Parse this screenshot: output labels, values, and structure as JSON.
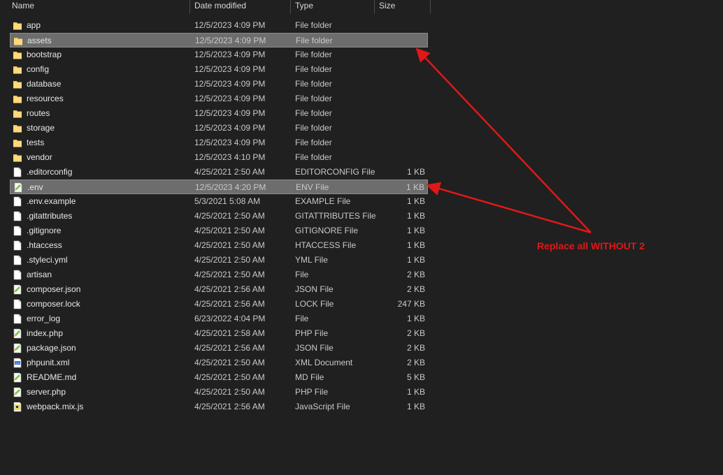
{
  "columns": {
    "name": "Name",
    "date": "Date modified",
    "type": "Type",
    "size": "Size"
  },
  "files": [
    {
      "name": "app",
      "date": "12/5/2023 4:09 PM",
      "type": "File folder",
      "size": "",
      "icon": "folder-icon",
      "selected": false
    },
    {
      "name": "assets",
      "date": "12/5/2023 4:09 PM",
      "type": "File folder",
      "size": "",
      "icon": "folder-icon",
      "selected": true
    },
    {
      "name": "bootstrap",
      "date": "12/5/2023 4:09 PM",
      "type": "File folder",
      "size": "",
      "icon": "folder-icon",
      "selected": false
    },
    {
      "name": "config",
      "date": "12/5/2023 4:09 PM",
      "type": "File folder",
      "size": "",
      "icon": "folder-icon",
      "selected": false
    },
    {
      "name": "database",
      "date": "12/5/2023 4:09 PM",
      "type": "File folder",
      "size": "",
      "icon": "folder-icon",
      "selected": false
    },
    {
      "name": "resources",
      "date": "12/5/2023 4:09 PM",
      "type": "File folder",
      "size": "",
      "icon": "folder-icon",
      "selected": false
    },
    {
      "name": "routes",
      "date": "12/5/2023 4:09 PM",
      "type": "File folder",
      "size": "",
      "icon": "folder-icon",
      "selected": false
    },
    {
      "name": "storage",
      "date": "12/5/2023 4:09 PM",
      "type": "File folder",
      "size": "",
      "icon": "folder-icon",
      "selected": false
    },
    {
      "name": "tests",
      "date": "12/5/2023 4:09 PM",
      "type": "File folder",
      "size": "",
      "icon": "folder-icon",
      "selected": false
    },
    {
      "name": "vendor",
      "date": "12/5/2023 4:10 PM",
      "type": "File folder",
      "size": "",
      "icon": "folder-icon",
      "selected": false
    },
    {
      "name": ".editorconfig",
      "date": "4/25/2021 2:50 AM",
      "type": "EDITORCONFIG File",
      "size": "1 KB",
      "icon": "file-icon",
      "selected": false
    },
    {
      "name": ".env",
      "date": "12/5/2023 4:20 PM",
      "type": "ENV File",
      "size": "1 KB",
      "icon": "notepadpp-file-icon",
      "selected": true
    },
    {
      "name": ".env.example",
      "date": "5/3/2021 5:08 AM",
      "type": "EXAMPLE File",
      "size": "1 KB",
      "icon": "file-icon",
      "selected": false
    },
    {
      "name": ".gitattributes",
      "date": "4/25/2021 2:50 AM",
      "type": "GITATTRIBUTES File",
      "size": "1 KB",
      "icon": "file-icon",
      "selected": false
    },
    {
      "name": ".gitignore",
      "date": "4/25/2021 2:50 AM",
      "type": "GITIGNORE File",
      "size": "1 KB",
      "icon": "file-icon",
      "selected": false
    },
    {
      "name": ".htaccess",
      "date": "4/25/2021 2:50 AM",
      "type": "HTACCESS File",
      "size": "1 KB",
      "icon": "file-icon",
      "selected": false
    },
    {
      "name": ".styleci.yml",
      "date": "4/25/2021 2:50 AM",
      "type": "YML File",
      "size": "1 KB",
      "icon": "file-icon",
      "selected": false
    },
    {
      "name": "artisan",
      "date": "4/25/2021 2:50 AM",
      "type": "File",
      "size": "2 KB",
      "icon": "file-icon",
      "selected": false
    },
    {
      "name": "composer.json",
      "date": "4/25/2021 2:56 AM",
      "type": "JSON File",
      "size": "2 KB",
      "icon": "notepadpp-file-icon",
      "selected": false
    },
    {
      "name": "composer.lock",
      "date": "4/25/2021 2:56 AM",
      "type": "LOCK File",
      "size": "247 KB",
      "icon": "file-icon",
      "selected": false
    },
    {
      "name": "error_log",
      "date": "6/23/2022 4:04 PM",
      "type": "File",
      "size": "1 KB",
      "icon": "file-icon",
      "selected": false
    },
    {
      "name": "index.php",
      "date": "4/25/2021 2:58 AM",
      "type": "PHP File",
      "size": "2 KB",
      "icon": "notepadpp-file-icon",
      "selected": false
    },
    {
      "name": "package.json",
      "date": "4/25/2021 2:56 AM",
      "type": "JSON File",
      "size": "2 KB",
      "icon": "notepadpp-file-icon",
      "selected": false
    },
    {
      "name": "phpunit.xml",
      "date": "4/25/2021 2:50 AM",
      "type": "XML Document",
      "size": "2 KB",
      "icon": "xml-file-icon",
      "selected": false
    },
    {
      "name": "README.md",
      "date": "4/25/2021 2:50 AM",
      "type": "MD File",
      "size": "5 KB",
      "icon": "notepadpp-file-icon",
      "selected": false
    },
    {
      "name": "server.php",
      "date": "4/25/2021 2:50 AM",
      "type": "PHP File",
      "size": "1 KB",
      "icon": "notepadpp-file-icon",
      "selected": false
    },
    {
      "name": "webpack.mix.js",
      "date": "4/25/2021 2:56 AM",
      "type": "JavaScript File",
      "size": "1 KB",
      "icon": "js-file-icon",
      "selected": false
    }
  ],
  "annotation": {
    "text": "Replace all WITHOUT 2",
    "color": "#e01818"
  },
  "colors": {
    "background": "#202020",
    "selection": "#6d6d6d",
    "folder": "#f4c95d"
  }
}
